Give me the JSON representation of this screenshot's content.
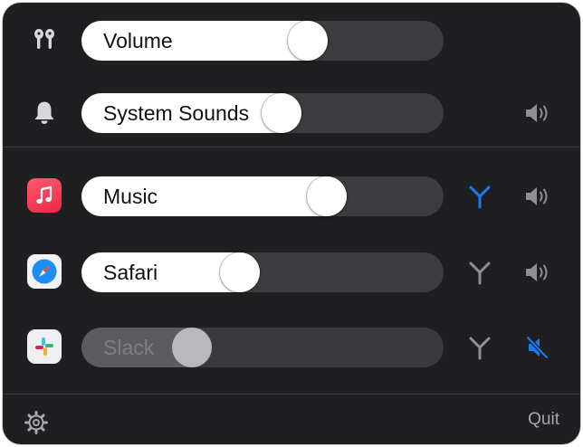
{
  "rows": [
    {
      "label": "Volume",
      "level": 0.64,
      "enabled": true
    },
    {
      "label": "System Sounds",
      "level": 0.56,
      "enabled": true
    },
    {
      "label": "Music",
      "level": 0.7,
      "enabled": true
    },
    {
      "label": "Safari",
      "level": 0.43,
      "enabled": true
    },
    {
      "label": "Slack",
      "level": 0.28,
      "enabled": false
    }
  ],
  "icons": {
    "volume": "earbuds-icon",
    "system_sounds": "bell-icon",
    "music": "music-app-icon",
    "safari": "safari-app-icon",
    "slack": "slack-app-icon",
    "route": "output-route-icon",
    "speaker": "speaker-icon",
    "speaker_muted": "speaker-muted-icon",
    "settings": "gear-icon"
  },
  "colors": {
    "accent_blue": "#1a7cf2",
    "icon_gray": "#8e8e93",
    "panel_bg": "#1f1f21"
  },
  "footer": {
    "quit_label": "Quit"
  }
}
